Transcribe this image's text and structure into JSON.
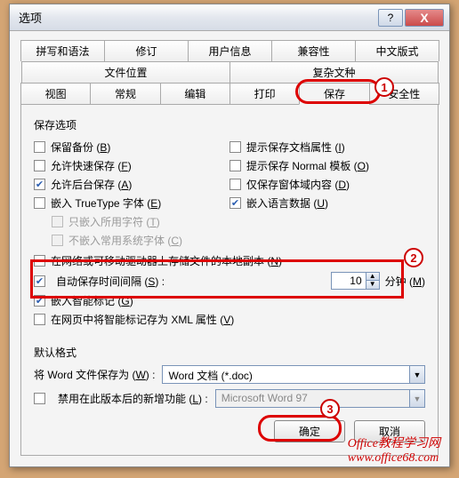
{
  "title": "选项",
  "tabs_row1": [
    "拼写和语法",
    "修订",
    "用户信息",
    "兼容性",
    "中文版式"
  ],
  "tabs_row2": [
    "文件位置",
    "复杂文种"
  ],
  "tabs_row3": [
    "视图",
    "常规",
    "编辑",
    "打印",
    "保存",
    "安全性"
  ],
  "active_tab": "保存",
  "section_save": "保存选项",
  "opts_left": [
    {
      "label": "保留备份 (",
      "ak": "B",
      "tail": ")",
      "checked": false
    },
    {
      "label": "允许快速保存 (",
      "ak": "F",
      "tail": ")",
      "checked": false
    },
    {
      "label": "允许后台保存 (",
      "ak": "A",
      "tail": ")",
      "checked": true
    },
    {
      "label": "嵌入 TrueType 字体 (",
      "ak": "E",
      "tail": ")",
      "checked": false
    }
  ],
  "opts_left_sub": [
    {
      "label": "只嵌入所用字符 (",
      "ak": "T",
      "tail": ")"
    },
    {
      "label": "不嵌入常用系统字体 (",
      "ak": "C",
      "tail": ")"
    }
  ],
  "opts_right": [
    {
      "label": "提示保存文档属性 (",
      "ak": "I",
      "tail": ")",
      "checked": false
    },
    {
      "label": "提示保存 Normal 模板 (",
      "ak": "O",
      "tail": ")",
      "checked": false
    },
    {
      "label": "仅保存窗体域内容 (",
      "ak": "D",
      "tail": ")",
      "checked": false
    },
    {
      "label": "嵌入语言数据 (",
      "ak": "U",
      "tail": ")",
      "checked": true
    }
  ],
  "opt_network": {
    "label": "在网络或可移动驱动器上存储文件的本地副本 (",
    "ak": "N",
    "tail": ")",
    "checked": false
  },
  "autosave": {
    "label_pre": "自动保存时间间隔 (",
    "ak": "S",
    "tail": ") :",
    "value": "10",
    "unit_pre": "分钟 (",
    "unit_ak": "M",
    "unit_tail": ")",
    "checked": true
  },
  "opt_smarttag": {
    "label": "嵌入智能标记 (",
    "ak": "G",
    "tail": ")",
    "checked": true
  },
  "opt_xmlsmart": {
    "label": "在网页中将智能标记存为 XML 属性 (",
    "ak": "V",
    "tail": ")",
    "checked": false
  },
  "section_default": "默认格式",
  "saveas": {
    "label_pre": "将 Word 文件保存为 (",
    "ak": "W",
    "tail": ") :",
    "value": "Word 文档 (*.doc)"
  },
  "disable_new": {
    "label_pre": "禁用在此版本后的新增功能 (",
    "ak": "L",
    "tail": ") :",
    "value": "Microsoft Word 97",
    "checked": false
  },
  "buttons": {
    "ok": "确定",
    "cancel": "取消"
  },
  "badges": {
    "b1": "1",
    "b2": "2",
    "b3": "3"
  },
  "watermark": "Office教程学习网\nwww.office68.com"
}
